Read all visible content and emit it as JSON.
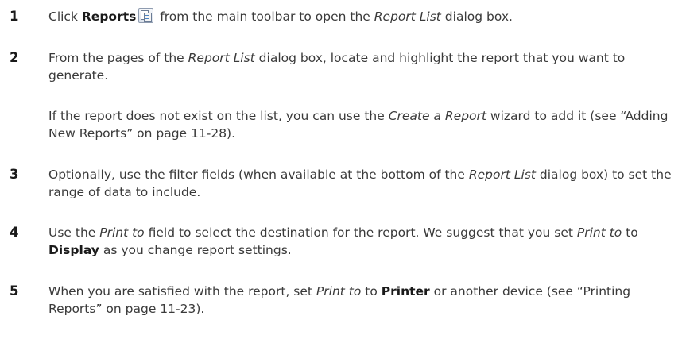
{
  "steps": [
    {
      "num": "1",
      "p1_a": "Click ",
      "p1_b": "Reports",
      "p1_c": " from the main toolbar to open the ",
      "p1_d": "Report List",
      "p1_e": " dialog box."
    },
    {
      "num": "2",
      "p1_a": "From the pages of the ",
      "p1_b": "Report List",
      "p1_c": " dialog box, locate and highlight the report that you want to generate.",
      "p2_a": "If the report does not exist on the list, you can use the ",
      "p2_b": "Create a Report",
      "p2_c": " wizard to add it (see “Adding New Reports” on page 11-28)."
    },
    {
      "num": "3",
      "p1_a": "Optionally, use the filter fields (when available at the bottom of the ",
      "p1_b": "Report List",
      "p1_c": " dialog box) to set the range of data to include."
    },
    {
      "num": "4",
      "p1_a": "Use the ",
      "p1_b": "Print to",
      "p1_c": " field to select the destination for the report. We suggest that you set ",
      "p1_d": "Print to",
      "p1_e": " to ",
      "p1_f": "Display",
      "p1_g": " as you change report settings."
    },
    {
      "num": "5",
      "p1_a": "When you are satisfied with the report, set ",
      "p1_b": "Print to",
      "p1_c": " to ",
      "p1_d": "Printer",
      "p1_e": " or another device (see “Printing Reports” on page 11-23)."
    }
  ],
  "icons": {
    "reports": "reports-icon"
  }
}
